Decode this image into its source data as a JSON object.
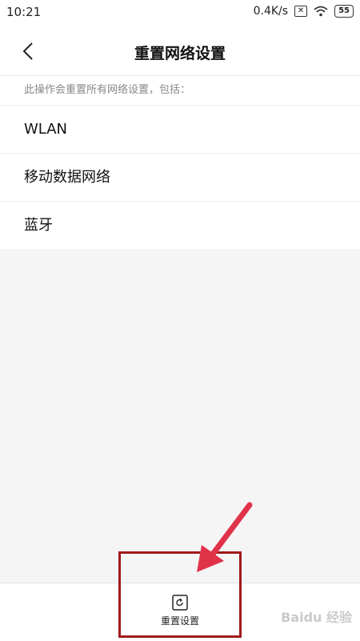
{
  "status_bar": {
    "time": "10:21",
    "speed": "0.4K/s",
    "battery": "55",
    "wifi_icon": "wifi-icon",
    "no_sim_icon": "no-sim-icon"
  },
  "header": {
    "title": "重置网络设置",
    "back_icon": "chevron-left-icon"
  },
  "content": {
    "description": "此操作会重置所有网络设置，包括：",
    "items": [
      {
        "label": "WLAN"
      },
      {
        "label": "移动数据网络"
      },
      {
        "label": "蓝牙"
      }
    ]
  },
  "bottom_bar": {
    "reset_label": "重置设置",
    "reset_icon": "reset-icon"
  },
  "annotation": {
    "highlight_color": "#a01a1a",
    "arrow_color": "#e0334a"
  },
  "watermark": "Baidu 经验"
}
